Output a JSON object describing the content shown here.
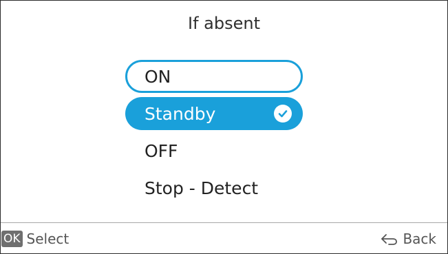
{
  "screen": {
    "title": "If absent"
  },
  "options": [
    {
      "label": "ON",
      "state": "focused"
    },
    {
      "label": "Standby",
      "state": "selected"
    },
    {
      "label": "OFF",
      "state": "normal"
    },
    {
      "label": "Stop - Detect",
      "state": "normal"
    }
  ],
  "footer": {
    "ok_badge": "OK",
    "select_label": "Select",
    "back_label": "Back"
  },
  "icons": {
    "selected": "checkmark-circle-icon",
    "back": "return-arrow-icon"
  },
  "colors": {
    "accent": "#1aa0da",
    "badge": "#6f6f6f"
  }
}
